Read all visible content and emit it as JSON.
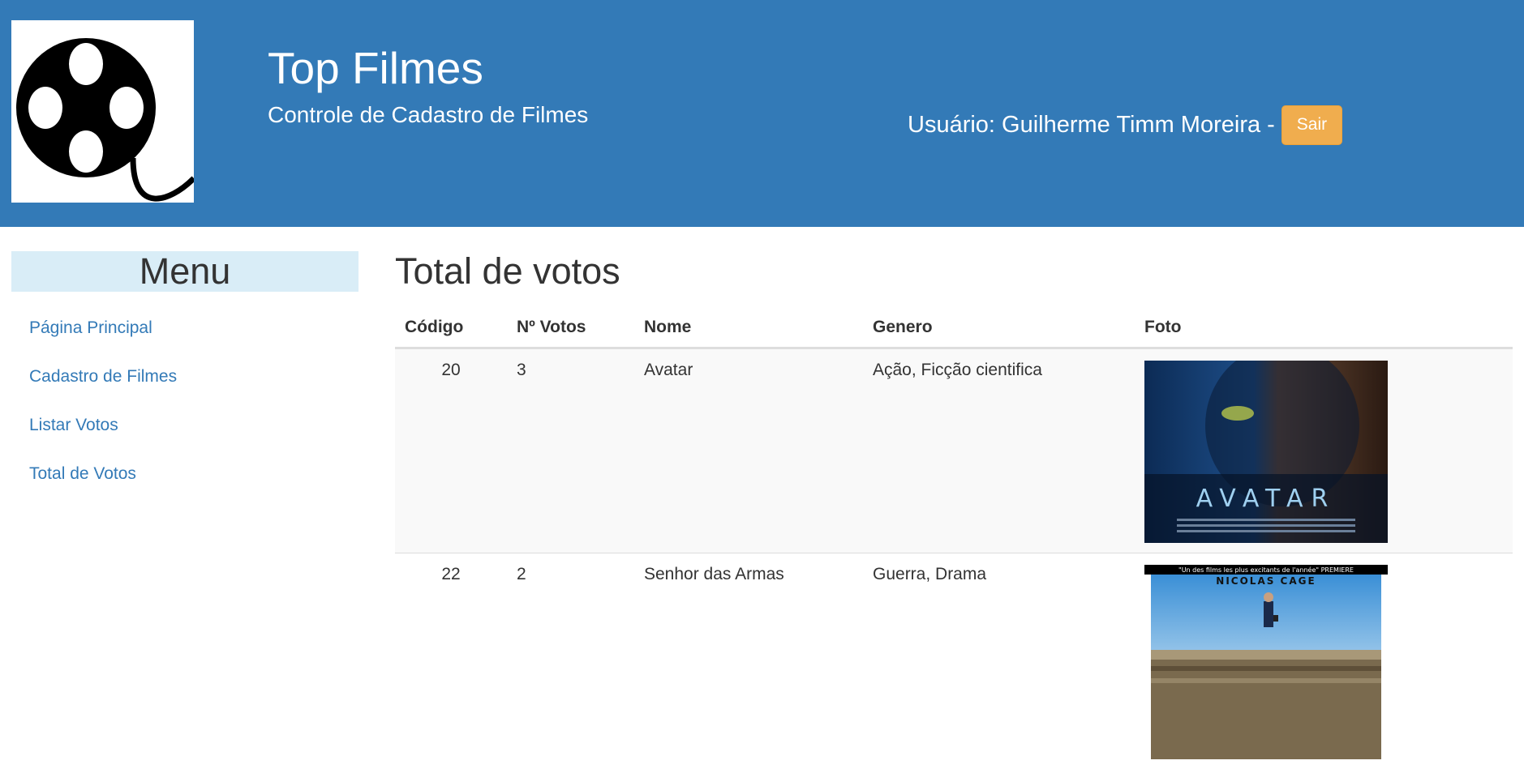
{
  "header": {
    "title": "Top Filmes",
    "subtitle": "Controle de Cadastro de Filmes",
    "user_label": "Usuário: Guilherme Timm Moreira",
    "user_separator": "-",
    "logout_label": "Sair",
    "logo_icon": "film-reel-icon"
  },
  "sidebar": {
    "title": "Menu",
    "items": [
      {
        "label": "Página Principal"
      },
      {
        "label": "Cadastro de Filmes"
      },
      {
        "label": "Listar Votos"
      },
      {
        "label": "Total de Votos"
      }
    ]
  },
  "main": {
    "heading": "Total de votos",
    "columns": [
      "Código",
      "Nº Votos",
      "Nome",
      "Genero",
      "Foto"
    ],
    "rows": [
      {
        "code": "20",
        "votes": "3",
        "name": "Avatar",
        "genre": "Ação, Ficção cientifica",
        "poster_text": "AVATAR"
      },
      {
        "code": "22",
        "votes": "2",
        "name": "Senhor das Armas",
        "genre": "Guerra, Drama",
        "poster_tagline": "\"Un des films les plus excitants de l'année\" PREMIERE",
        "poster_text": "NICOLAS CAGE"
      }
    ]
  },
  "colors": {
    "header_bg": "#337ab7",
    "menu_title_bg": "#d9edf7",
    "link": "#337ab7",
    "logout_button": "#f0ad4e"
  }
}
